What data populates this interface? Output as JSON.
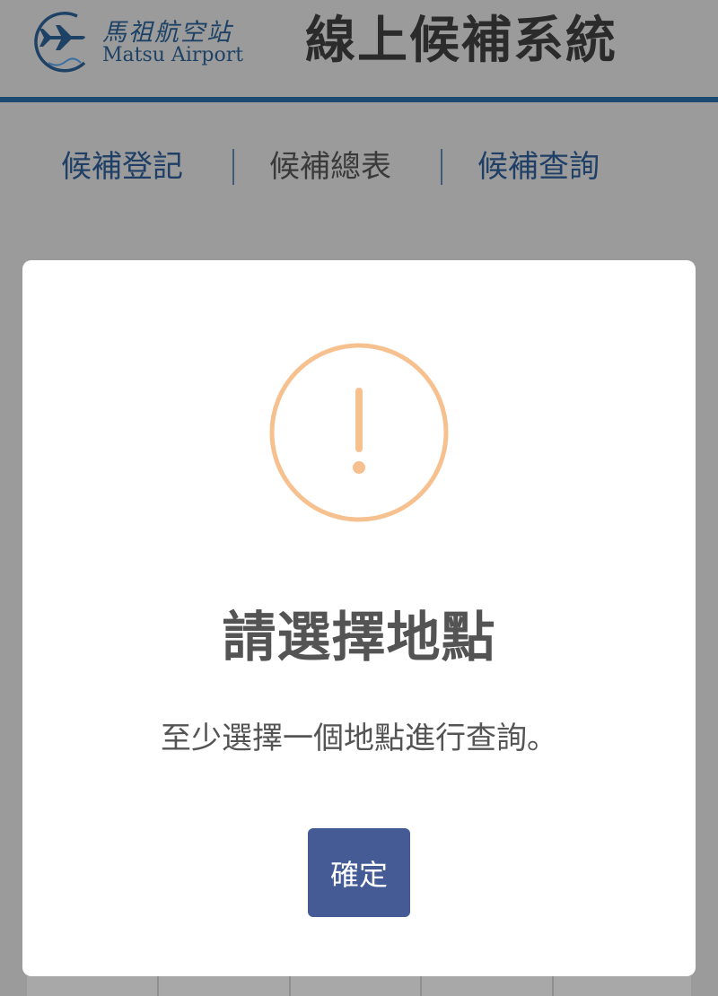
{
  "header": {
    "logo_cn": "馬祖航空站",
    "logo_en": "Matsu Airport",
    "title": "線上候補系統"
  },
  "nav": {
    "items": [
      {
        "label": "候補登記"
      },
      {
        "label": "候補總表"
      },
      {
        "label": "候補查詢"
      }
    ]
  },
  "dialog": {
    "icon": "exclamation-icon",
    "title": "請選擇地點",
    "message": "至少選擇一個地點進行查詢。",
    "confirm_label": "確定"
  },
  "colors": {
    "overlay": "#9b9b9b",
    "header_rule": "#1d4a73",
    "nav_link": "#1f3f66",
    "warning": "#f6c18f",
    "button": "#445b95",
    "title_text": "#545454"
  }
}
